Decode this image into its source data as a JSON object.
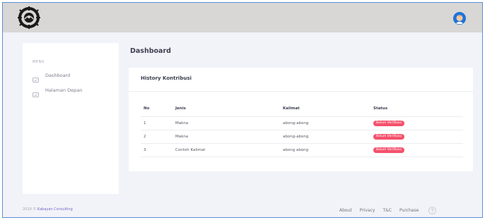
{
  "header": {
    "logo_icon": "university-seal-icon",
    "avatar_icon": "user-avatar-icon",
    "accent_color": "#1e73d8"
  },
  "sidebar": {
    "menu_title": "MENU",
    "items": [
      {
        "label": "Dashboard",
        "icon": "monitor-icon"
      },
      {
        "label": "Halaman Depan",
        "icon": "monitor-icon"
      }
    ]
  },
  "main": {
    "page_title": "Dashboard",
    "card": {
      "title": "History Kontribusi",
      "columns": [
        "No",
        "Jenis",
        "Kalimat",
        "Status"
      ],
      "rows": [
        {
          "no": "1",
          "jenis": "Makna",
          "kalimat": "abong-abong",
          "status": "Belum Verifikasi"
        },
        {
          "no": "2",
          "jenis": "Makna",
          "kalimat": "abong-abong",
          "status": "Belum Verifikasi"
        },
        {
          "no": "3",
          "jenis": "Contoh Kalimat",
          "kalimat": "abong abong",
          "status": "Belum Verifikasi"
        }
      ],
      "status_color": "#f4516c"
    }
  },
  "footer": {
    "copyright_prefix": "2019 © ",
    "brand": "Kabayan Consulting",
    "links": [
      "About",
      "Privacy",
      "T&C",
      "Purchase"
    ],
    "help_icon": "question-circle-icon"
  }
}
